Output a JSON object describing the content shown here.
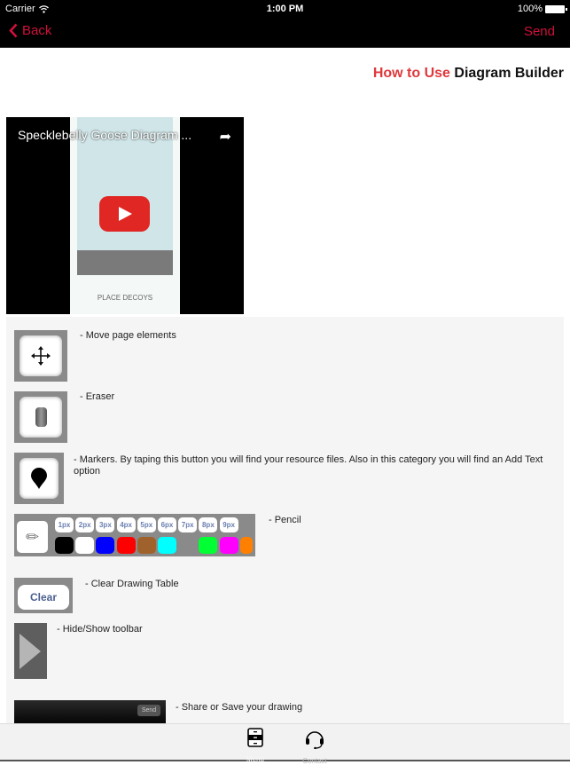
{
  "status_bar": {
    "carrier": "Carrier",
    "time": "1:00 PM",
    "battery": "100%"
  },
  "nav": {
    "back_label": "Back",
    "send_label": "Send",
    "accent_color": "#d0103a"
  },
  "page": {
    "title_accent": "How to Use",
    "title_rest": "Diagram Builder",
    "title_accent_color": "#e0383c"
  },
  "video": {
    "title": "Specklebelly Goose Diagram ...",
    "caption": "PLACE DECOYS"
  },
  "help_items": [
    {
      "icon": "move-icon",
      "text": "- Move page elements"
    },
    {
      "icon": "eraser-icon",
      "text": "- Eraser"
    },
    {
      "icon": "marker-icon",
      "text": "- Markers. By taping this button you will find your resource files. Also in this category you will find an Add Text option"
    },
    {
      "icon": "pencil-icon",
      "text": "- Pencil"
    },
    {
      "icon": "clear-icon",
      "text": "- Clear Drawing Table",
      "button_label": "Clear"
    },
    {
      "icon": "toggle-toolbar-icon",
      "text": "- Hide/Show toolbar"
    },
    {
      "icon": "share-icon",
      "text": "- Share or Save your drawing",
      "button_label": "Send"
    }
  ],
  "pencil": {
    "sizes": [
      "1px",
      "2px",
      "3px",
      "4px",
      "5px",
      "6px",
      "7px",
      "8px",
      "9px"
    ],
    "colors": [
      "#000000",
      "#ffffff",
      "#0000ff",
      "#ff0000",
      "#a0622d",
      "#00ffff",
      "#8a8a8a",
      "#00ff33",
      "#ff00ff",
      "#ff8000"
    ]
  },
  "tab_bar": {
    "menu_label": "Menu",
    "contact_label": "Contact"
  }
}
